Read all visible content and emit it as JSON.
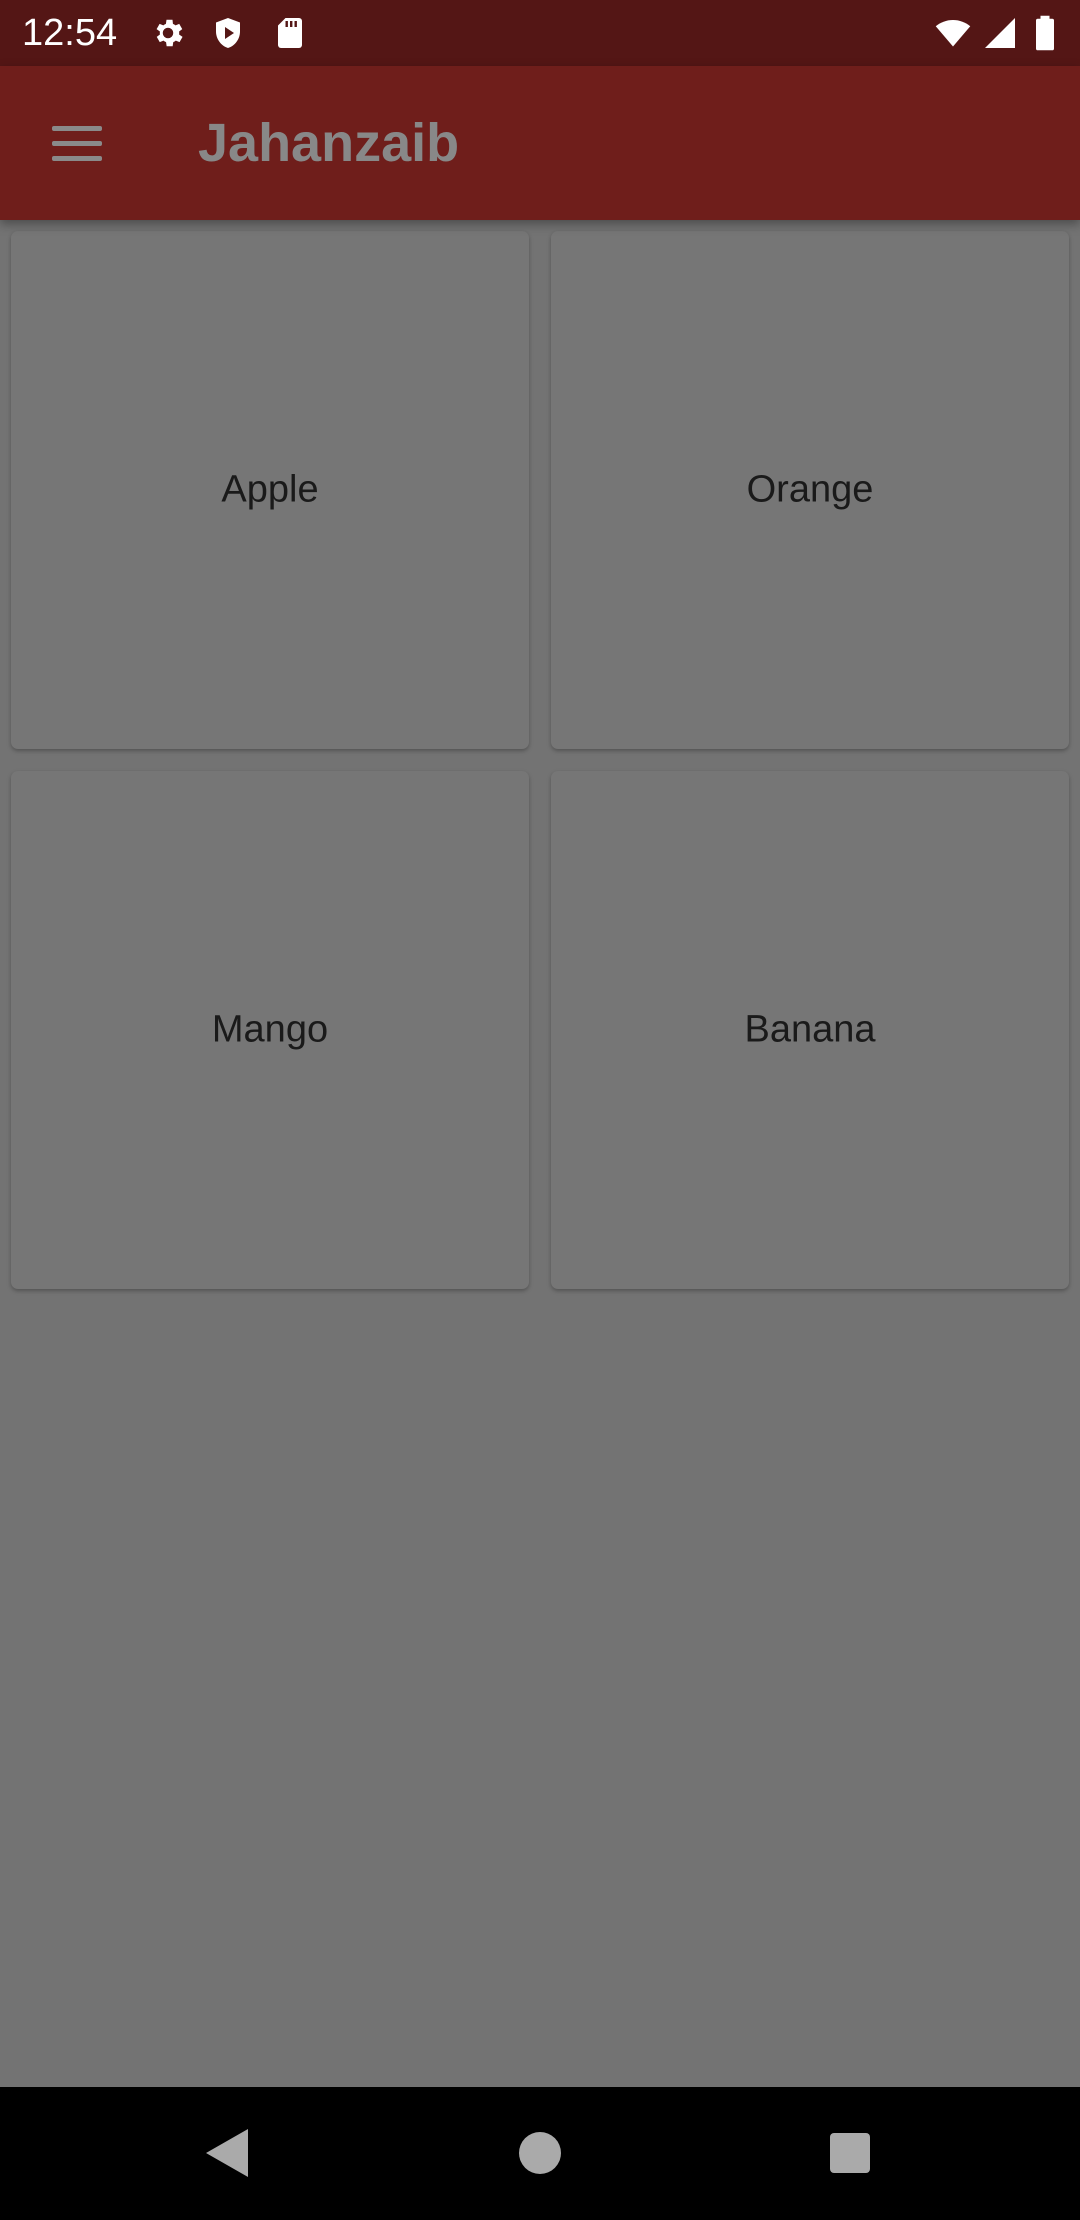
{
  "status_bar": {
    "time": "12:54",
    "icons_left": [
      "settings-icon",
      "shield-play-icon",
      "sd-card-icon"
    ],
    "icons_right": [
      "wifi-icon",
      "cell-signal-icon",
      "battery-icon"
    ]
  },
  "app_bar": {
    "menu_icon": "hamburger-menu-icon",
    "title": "Jahanzaib"
  },
  "cards": [
    {
      "label": "Apple"
    },
    {
      "label": "Orange"
    },
    {
      "label": "Mango"
    },
    {
      "label": "Banana"
    }
  ],
  "nav_bar": {
    "buttons": [
      "back-icon",
      "home-icon",
      "recents-icon"
    ]
  },
  "colors": {
    "status_bar": "#541615",
    "app_bar": "#6f1e1b",
    "scrim_background": "#737373",
    "card": "#767676",
    "title_text": "#888888",
    "card_text": "#1a1a1a"
  }
}
